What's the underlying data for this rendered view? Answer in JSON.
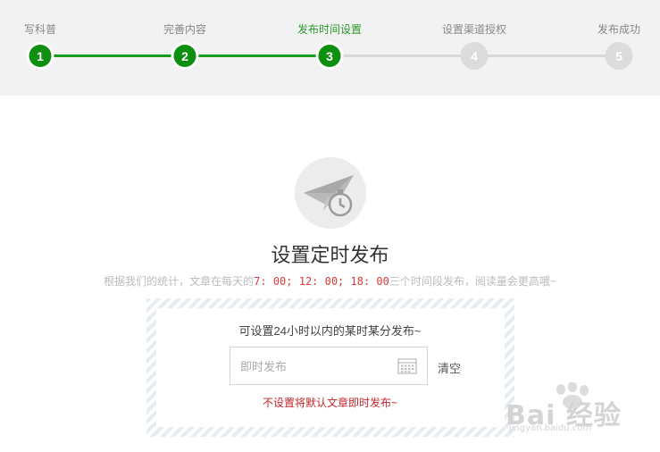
{
  "steps": [
    {
      "label": "写科普",
      "number": "1",
      "status": "done"
    },
    {
      "label": "完善内容",
      "number": "2",
      "status": "done"
    },
    {
      "label": "发布时间设置",
      "number": "3",
      "status": "current"
    },
    {
      "label": "设置渠道授权",
      "number": "4",
      "status": "todo"
    },
    {
      "label": "发布成功",
      "number": "5",
      "status": "todo"
    }
  ],
  "main": {
    "icon": "paper-plane-timer-icon",
    "title": "设置定时发布",
    "subtitle_prefix": "根据我们的统计，文章在每天的",
    "subtitle_times": "7: 00; 12: 00; 18: 00",
    "subtitle_suffix": "三个时间段发布，阅读量会更高哦~",
    "hint": "可设置24小时以内的某时某分发布~",
    "input_placeholder": "即时发布",
    "input_icon": "calendar-icon",
    "clear_label": "清空",
    "warning": "不设置将默认文章即时发布~"
  },
  "watermark": {
    "logo": "Bai 经验",
    "url": "jingyan.baidu.com"
  },
  "colors": {
    "step_done": "#0f8f0f",
    "step_active_label": "#2a9a2a",
    "step_todo": "#dcdcdc",
    "highlight": "#d63b3b",
    "warning": "#c7262b"
  }
}
